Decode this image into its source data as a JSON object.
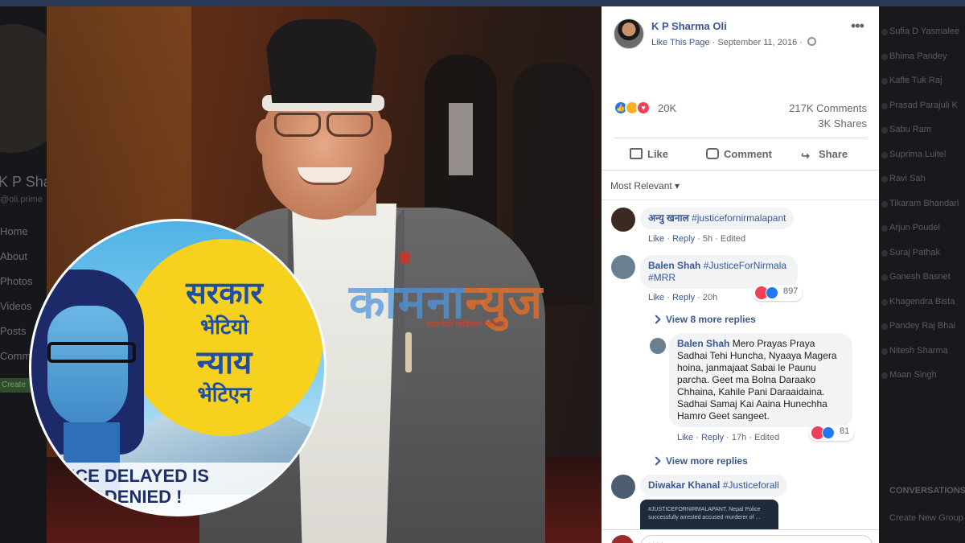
{
  "background": {
    "profile_name": "K P Sharma",
    "profile_handle": "@oli.prime",
    "nav": [
      "Home",
      "About",
      "Photos",
      "Videos",
      "Posts",
      "Community"
    ],
    "create_label": "Create",
    "contacts": [
      "Sufia D Yasmalee",
      "Bhima Pandey",
      "Kafle Tuk Raj",
      "Prasad Parajuli K",
      "Sabu Ram",
      "Suprima Luitel",
      "Ravi Sah",
      "Tikaram Bhandari",
      "Arjun Poudel",
      "Suraj Pathak",
      "Ganesh Basnet",
      "Khagendra Bista",
      "Pandey Raj Bhai",
      "Nitesh Sharma",
      "Maan Singh"
    ],
    "conversations_label": "CONVERSATIONS",
    "create_group_label": "Create New Group"
  },
  "photo": {
    "watermark": {
      "part1": "काम",
      "part2": "ना",
      "part3": "न्युज",
      "subtitle": "समावेशी डिजिटल पत्रिका"
    },
    "badge": {
      "line1": "सरकार",
      "line2": "भेटियो",
      "line3": "न्याय",
      "line4": "भेटिएन",
      "banner1": "STICE DELAYED IS",
      "banner2": "STICE DENIED !"
    }
  },
  "post": {
    "author": "K P Sharma Oli",
    "like_page": "Like This Page",
    "date": "September 11, 2016",
    "reaction_count": "20K",
    "comments": "217K Comments",
    "shares": "3K Shares",
    "actions": {
      "like": "Like",
      "comment": "Comment",
      "share": "Share"
    },
    "sort_label": "Most Relevant ▾"
  },
  "comments": [
    {
      "author": "अन्यु खनाल",
      "text": "#justicefornirmalapant",
      "like": "Like",
      "reply": "Reply",
      "time": "5h",
      "extra": "Edited"
    },
    {
      "author": "Balen Shah",
      "text": "#JusticeForNirmala #MRR",
      "like": "Like",
      "reply": "Reply",
      "time": "20h",
      "reactions": "897",
      "view_replies": "View 8 more replies"
    },
    {
      "author": "Balen Shah",
      "text": "Mero Prayas Praya Sadhai Tehi Huncha, Nyaaya Magera hoina, janmajaat Sabai le Paunu parcha. Geet ma Bolna Daraako Chhaina, Kahile Pani Daraaidaina. Sadhai Samaj Kai Aaina Hunechha Hamro Geet sangeet.",
      "like": "Like",
      "reply": "Reply",
      "time": "17h",
      "extra": "Edited",
      "reactions": "81",
      "view_more": "View more replies"
    },
    {
      "author": "Diwakar Khanal",
      "text": "#Justiceforall",
      "image_caption": "#JUSTICEFORNIRMALAPANT. Nepal Police successfully arrested accused murderer of ..."
    }
  ],
  "compose_placeholder": "Write a comment..."
}
